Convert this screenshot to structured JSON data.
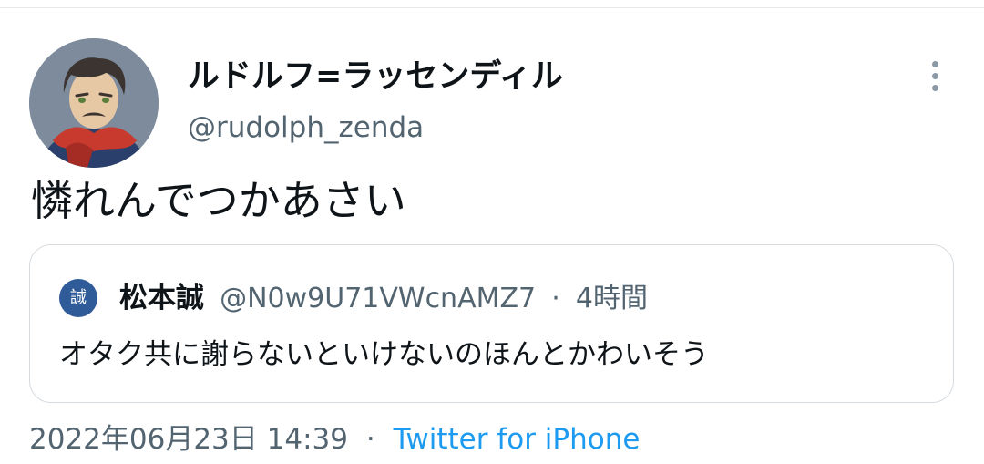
{
  "tweet": {
    "author": {
      "display_name": "ルドルフ=ラッセンディル",
      "handle": "@rudolph_zenda",
      "avatar_icon": "character-portrait-avatar"
    },
    "text": "憐れんでつかあさい",
    "more_icon": "more-vertical-icon"
  },
  "quote": {
    "avatar_glyph": "誠",
    "name": "松本誠",
    "handle": "@N0w9U71VWcnAMZ7",
    "separator": "·",
    "time": "4時間",
    "text": "オタク共に謝らないといけないのほんとかわいそう"
  },
  "meta": {
    "timestamp": "2022年06月23日 14:39",
    "separator": "·",
    "source": "Twitter for iPhone"
  },
  "colors": {
    "accent": "#1d9bf0",
    "secondary_text": "#536471",
    "quote_avatar_bg": "#2f5b98"
  }
}
